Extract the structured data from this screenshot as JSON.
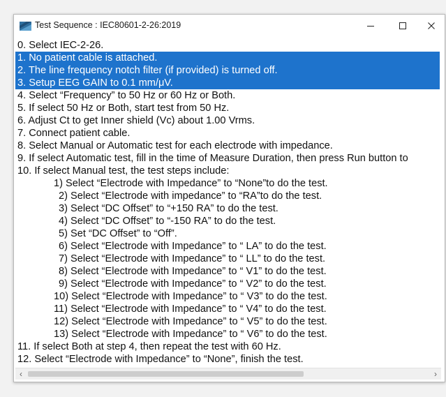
{
  "window": {
    "title": "Test Sequence : IEC80601-2-26:2019",
    "icon": "app-window-icon",
    "controls": {
      "minimize": "—",
      "maximize": "☐",
      "close": "✕"
    }
  },
  "lines": [
    "0. Select IEC-2-26.",
    "1. No patient cable is attached.",
    "2. The line frequency notch filter (if provided) is turned off.",
    "3. Setup EEG GAIN to 0.1 mm/μV.",
    "4. Select “Frequency” to 50 Hz or 60 Hz or Both.",
    "5. If select 50 Hz or Both, start test from 50 Hz.",
    "6. Adjust Ct to get Inner shield (Vc) about 1.00 Vrms.",
    "7. Connect patient cable.",
    "8. Select Manual or Automatic test for each electrode with impedance.",
    "9. If select Automatic test, fill in the time of Measure Duration, then press Run button to",
    "10. If select Manual test, the test steps include:",
    "1) Select  “Electrode with Impedance” to “None”to do the test.",
    "2) Select “Electrode with impedance” to “RA”to do the test.",
    "3) Select “DC Offset” to “+150 RA” to do the test.",
    "4) Select “DC Offset” to  “-150 RA” to do the test.",
    "5) Set “DC Offset” to “Off”.",
    "6) Select “Electrode with Impedance” to “ LA” to do the test.",
    "7) Select “Electrode with Impedance” to “ LL” to do the test.",
    "8) Select “Electrode with Impedance” to “ V1” to do the test.",
    "9) Select “Electrode with Impedance” to “ V2” to do the test.",
    "10) Select “Electrode with Impedance” to “ V3” to do the test.",
    "11) Select “Electrode with Impedance” to “ V4” to do the test.",
    "12) Select “Electrode with Impedance” to “ V5” to do the test.",
    "13) Select “Electrode with Impedance” to “ V6” to do the test.",
    "11. If select Both at step 4, then repeat the test with 60 Hz.",
    "12. Select “Electrode with Impedance” to “None”, finish the test."
  ],
  "selected_lines": [
    1,
    2,
    3
  ],
  "scrollbar": {
    "left_arrow": "‹",
    "right_arrow": "›",
    "position": 0
  },
  "colors": {
    "selection": "#1e73cc",
    "selection_text": "#ffffff",
    "icon": "#2f6f9f"
  }
}
